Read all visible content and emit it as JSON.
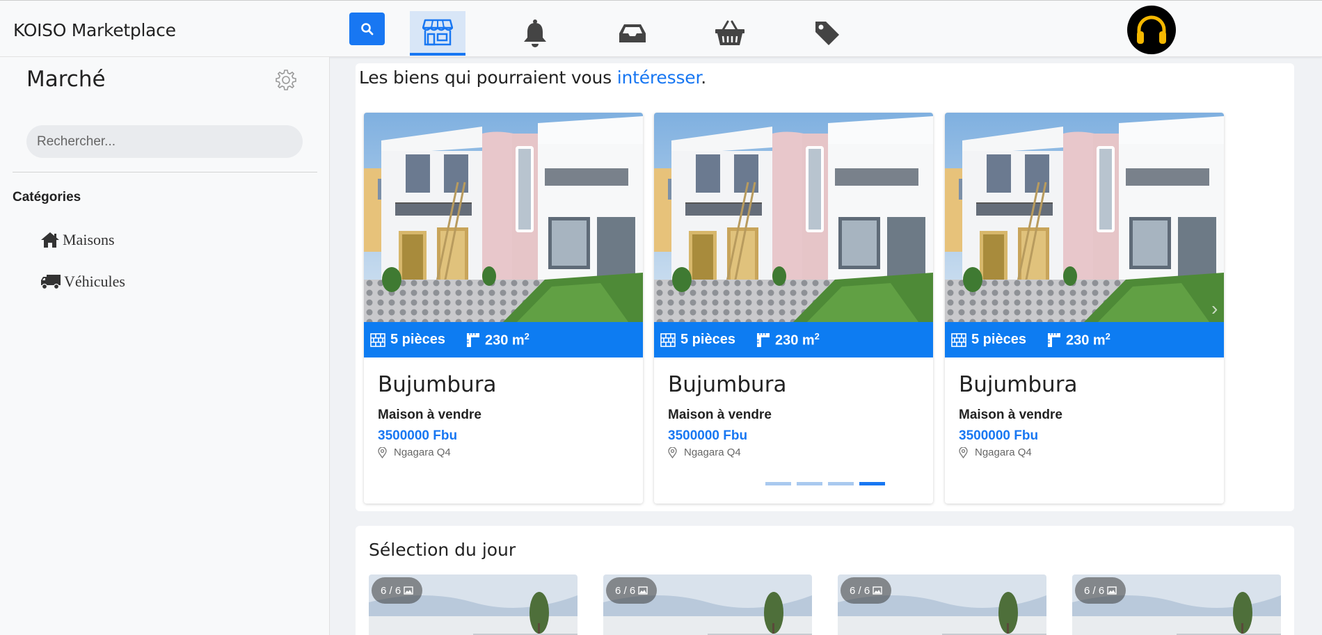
{
  "navbar": {
    "brand": "KOISO Marketplace",
    "nav_items": [
      {
        "icon": "store-icon",
        "active": true
      },
      {
        "icon": "bell-icon",
        "active": false
      },
      {
        "icon": "inbox-icon",
        "active": false
      },
      {
        "icon": "shopping-basket-icon",
        "active": false
      },
      {
        "icon": "tag-icon",
        "active": false
      }
    ],
    "accent_color": "#1877f2"
  },
  "sidebar": {
    "title": "Marché",
    "search_placeholder": "Rechercher...",
    "categories_title": "Catégories",
    "categories": [
      {
        "label": "Maisons",
        "icon": "home-icon"
      },
      {
        "label": "Véhicules",
        "icon": "truck-icon"
      }
    ]
  },
  "recommendations": {
    "heading_prefix": "Les biens qui pourraient vous ",
    "heading_accent": "intéresser",
    "heading_suffix": ".",
    "cards": [
      {
        "rooms": "5 pièces",
        "area": "230 m",
        "area_sup": "2",
        "city": "Bujumbura",
        "type": "Maison à vendre",
        "price": "3500000 Fbu",
        "location": "Ngagara Q4"
      },
      {
        "rooms": "5 pièces",
        "area": "230 m",
        "area_sup": "2",
        "city": "Bujumbura",
        "type": "Maison à vendre",
        "price": "3500000 Fbu",
        "location": "Ngagara Q4"
      },
      {
        "rooms": "5 pièces",
        "area": "230 m",
        "area_sup": "2",
        "city": "Bujumbura",
        "type": "Maison à vendre",
        "price": "3500000 Fbu",
        "location": "Ngagara Q4"
      }
    ],
    "carousel_dots": 4,
    "carousel_active_dot": 4
  },
  "daily_selection": {
    "title": "Sélection du jour",
    "thumbs": [
      {
        "badge": "6 / 6"
      },
      {
        "badge": "6 / 6"
      },
      {
        "badge": "6 / 6"
      },
      {
        "badge": "6 / 6"
      }
    ]
  }
}
